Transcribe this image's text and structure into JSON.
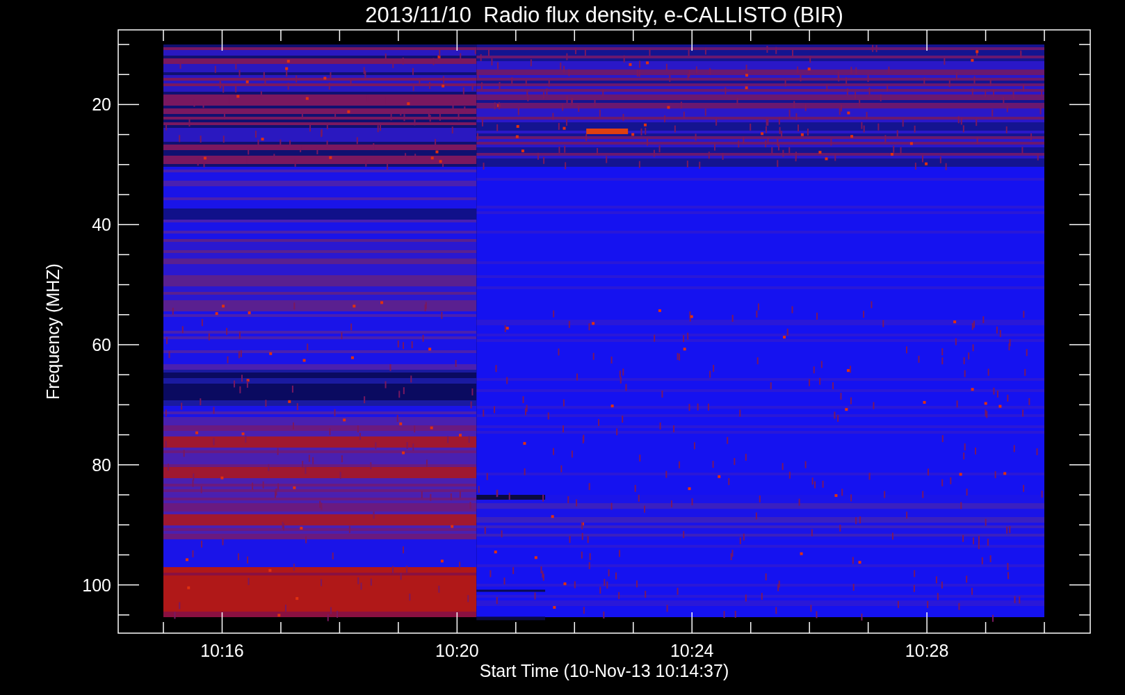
{
  "plot": {
    "title": "2013/11/10  Radio flux density, e-CALLISTO (BIR)",
    "ylabel": "Frequency (MHZ)",
    "xlabel": "Start Time (10-Nov-13 10:14:37)",
    "yticks": [
      "20",
      "40",
      "60",
      "80",
      "100"
    ],
    "xticks": [
      "10:16",
      "10:20",
      "10:24",
      "10:28"
    ]
  }
}
